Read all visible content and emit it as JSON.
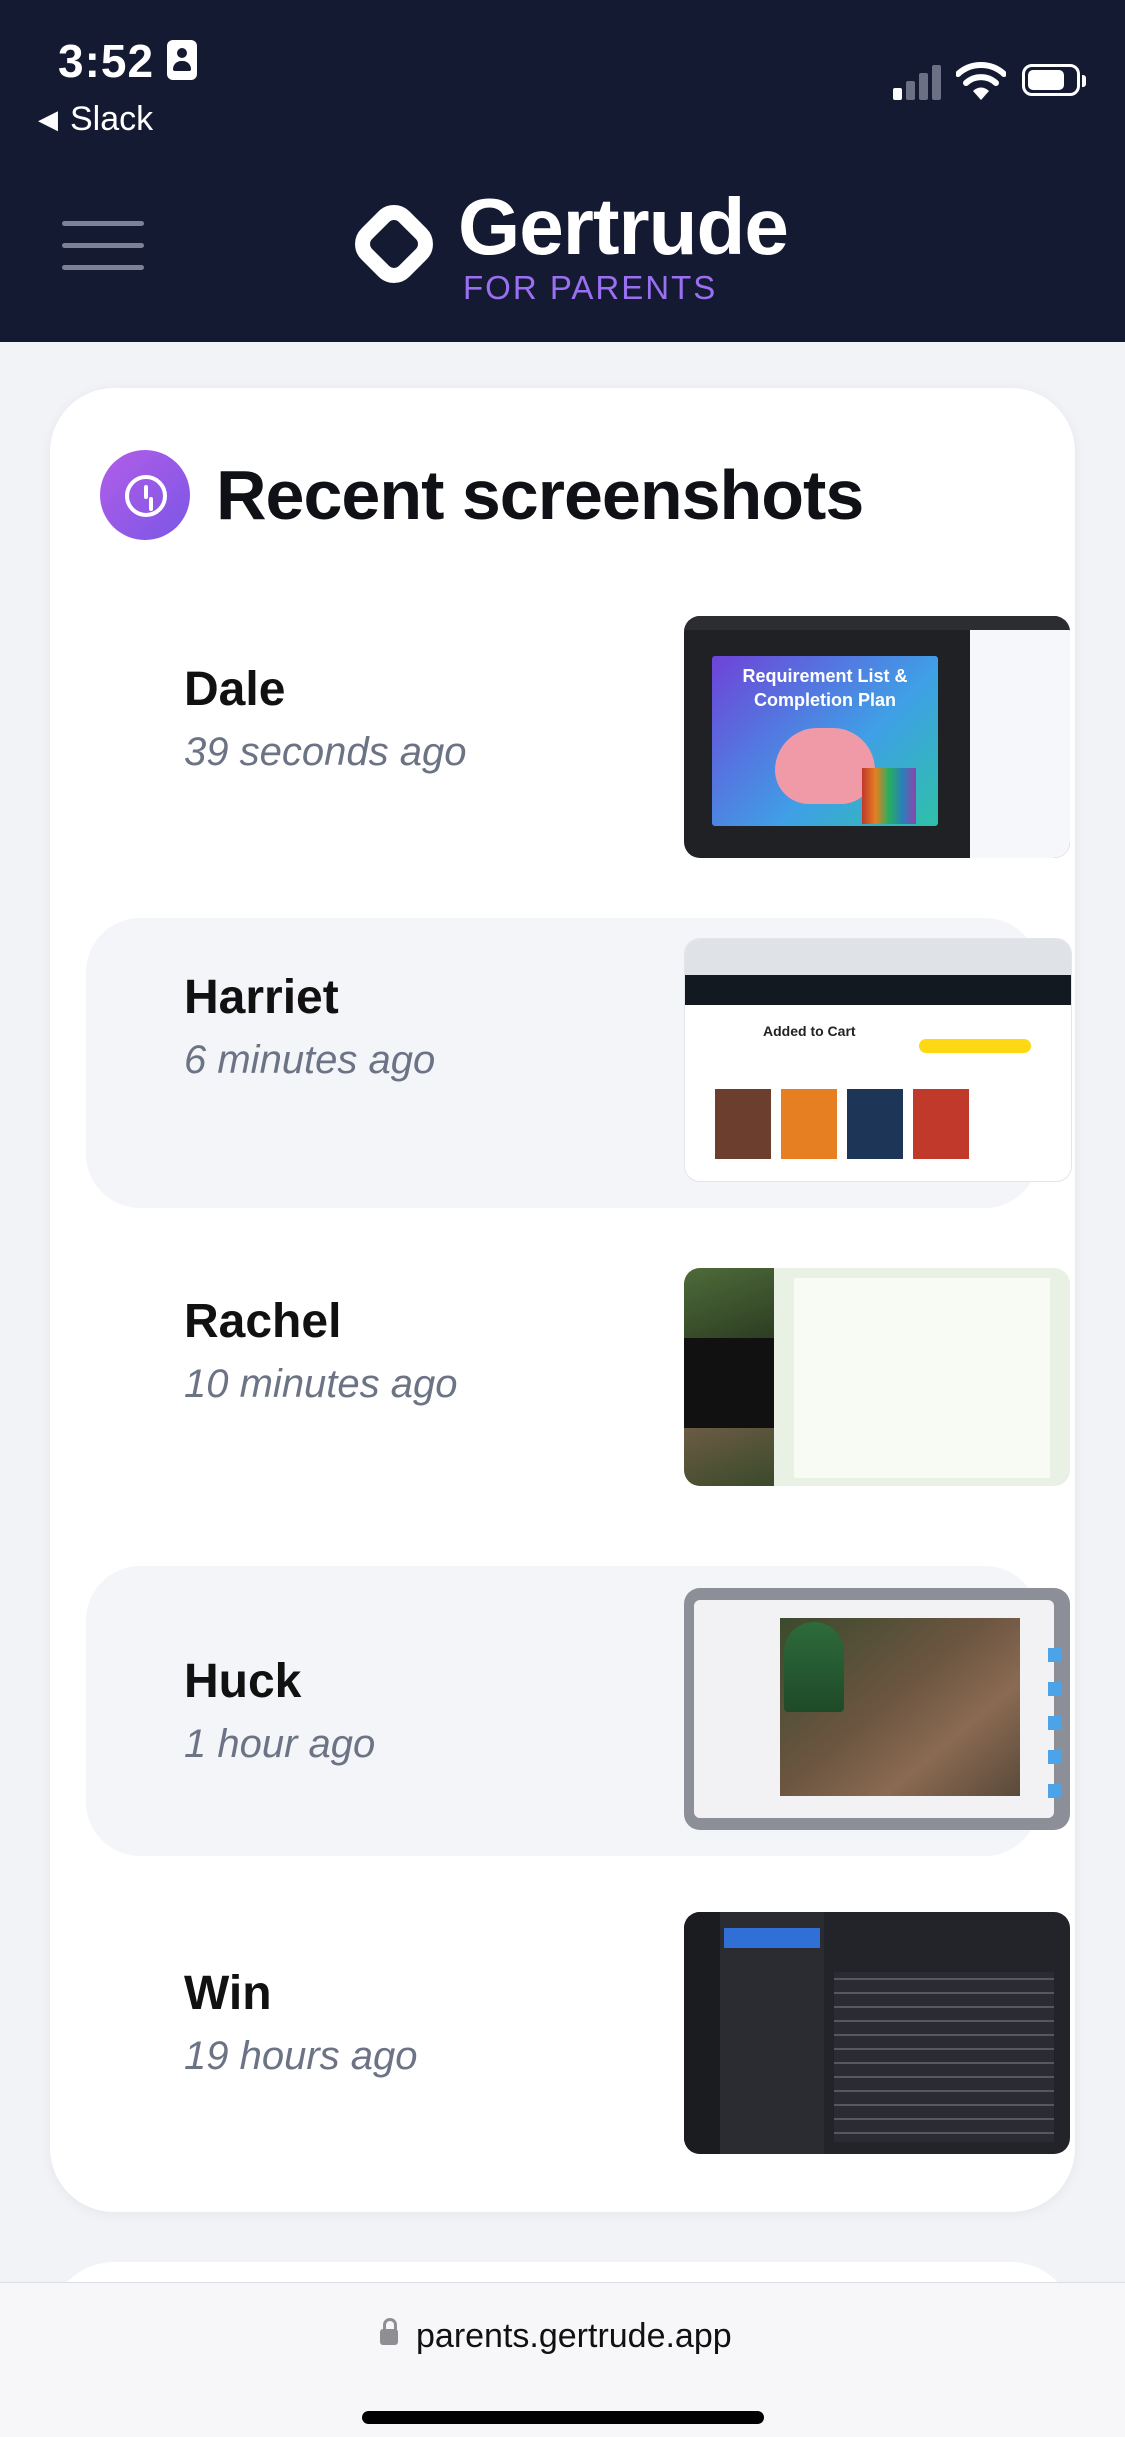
{
  "status_bar": {
    "time": "3:52",
    "back_app": "Slack"
  },
  "header": {
    "brand": "Gertrude",
    "sub": "FOR PARENTS"
  },
  "card": {
    "title": "Recent screenshots",
    "items": [
      {
        "name": "Dale",
        "ago": "39 seconds ago",
        "thumb_title": "Requirement List & Completion Plan"
      },
      {
        "name": "Harriet",
        "ago": "6 minutes ago",
        "thumb_text": "Added to Cart"
      },
      {
        "name": "Rachel",
        "ago": "10 minutes ago"
      },
      {
        "name": "Huck",
        "ago": "1 hour ago"
      },
      {
        "name": "Win",
        "ago": "19 hours ago"
      }
    ]
  },
  "browser": {
    "url": "parents.gertrude.app"
  }
}
